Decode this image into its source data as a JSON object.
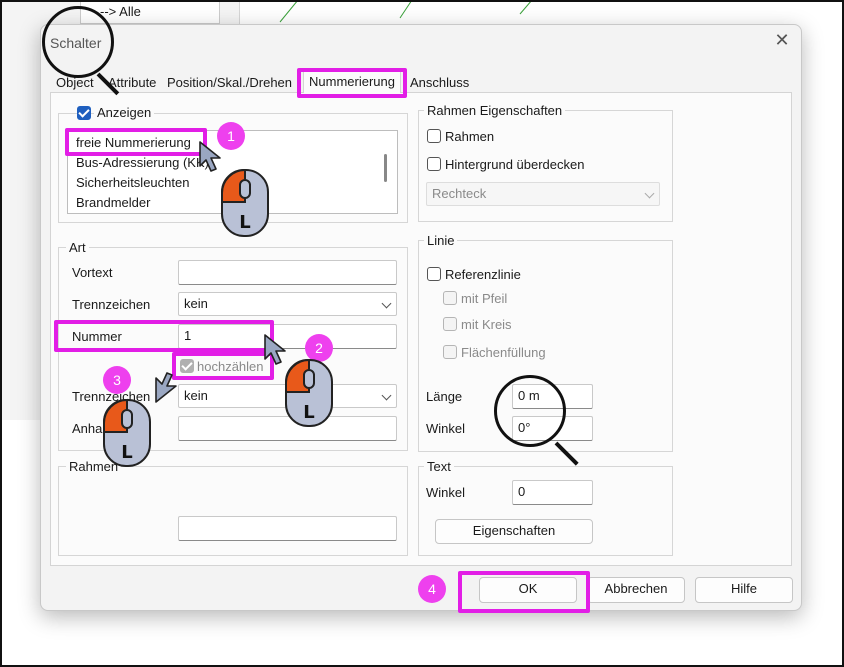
{
  "background": {
    "tree_item": "--> Alle"
  },
  "dialog": {
    "title": "Schalter",
    "tabs": [
      "Object",
      "Attribute",
      "Position/Skal./Drehen",
      "Nummerierung",
      "Anschluss"
    ],
    "active_tab": "Nummerierung",
    "anzeigen": {
      "label": "Anzeigen",
      "checked": true,
      "list_items": [
        "freie Nummerierung",
        "Bus-Adressierung (KK)",
        "Sicherheitsleuchten",
        "Brandmelder"
      ],
      "selected": "freie Nummerierung"
    },
    "art": {
      "legend": "Art",
      "vortext_label": "Vortext",
      "vortext_value": "",
      "trennzeichen1_label": "Trennzeichen",
      "trennzeichen1_value": "kein",
      "nummer_label": "Nummer",
      "nummer_value": "1",
      "hochzaehlen_label": "hochzählen",
      "trennzeichen2_label": "Trennzeichen",
      "trennzeichen2_value": "kein",
      "anhang_label": "Anhang",
      "anhang_value": ""
    },
    "rahmen_group": {
      "legend": "Rahmen",
      "value": ""
    },
    "rahmen_eigenschaften": {
      "legend": "Rahmen Eigenschaften",
      "rahmen_label": "Rahmen",
      "hintergrund_label": "Hintergrund überdecken",
      "shape_value": "Rechteck"
    },
    "linie": {
      "legend": "Linie",
      "referenzlinie_label": "Referenzlinie",
      "mit_pfeil_label": "mit Pfeil",
      "mit_kreis_label": "mit Kreis",
      "flaechenfuellung_label": "Flächenfüllung",
      "laenge_label": "Länge",
      "laenge_value": "0 m",
      "winkel_label": "Winkel",
      "winkel_value": "0°"
    },
    "text": {
      "legend": "Text",
      "winkel_label": "Winkel",
      "winkel_value": "0",
      "eigenschaften_label": "Eigenschaften"
    },
    "buttons": {
      "ok": "OK",
      "abbrechen": "Abbrechen",
      "hilfe": "Hilfe"
    }
  },
  "annotations": {
    "badges": [
      "1",
      "2",
      "3",
      "4"
    ],
    "mouse_label": "L",
    "highlight_color": "#e21ee6",
    "badge_color": "#ee40ee",
    "mouse_button_color": "#e8591a"
  }
}
